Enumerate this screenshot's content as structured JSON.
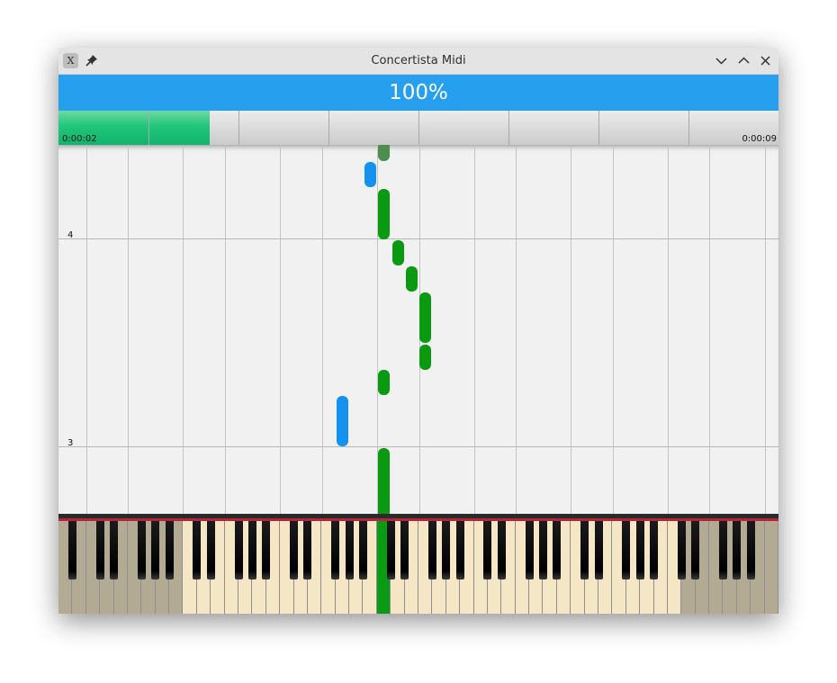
{
  "window": {
    "title": "Concertista Midi",
    "icons": [
      "app-icon",
      "pin-icon",
      "minimize-icon",
      "maximize-icon",
      "close-icon"
    ]
  },
  "player": {
    "speed": "100%",
    "progress_fraction": 0.21,
    "elapsed": "0:00:02",
    "total": "0:00:09"
  },
  "roll": {
    "measures": [
      "4",
      "3"
    ],
    "colors": {
      "right_hand": "#0a9a12",
      "left_hand": "#1592ef",
      "background": "#f1f1f1"
    }
  },
  "keyboard": {
    "colors": {
      "active_key": "#f5e6c5",
      "inactive_key": "#b3aa94",
      "pressed": "#0b9a13",
      "accent_line": "#b2253a"
    }
  }
}
